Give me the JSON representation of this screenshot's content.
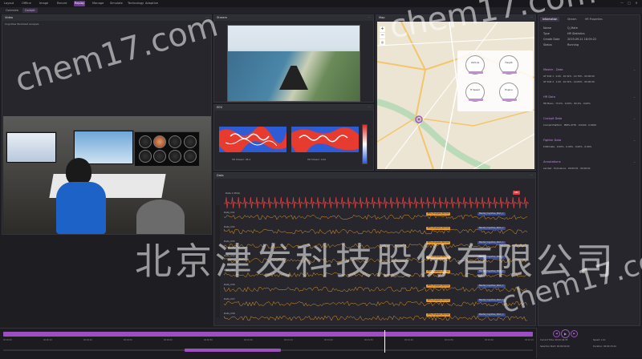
{
  "menubar": {
    "items": [
      "Layout",
      "Offline",
      "Image",
      "Record",
      "Replay",
      "Manage",
      "Simulate",
      "Technology",
      "Adaptive"
    ],
    "active_index": 4,
    "window_controls": [
      "—",
      "□",
      "✕"
    ]
  },
  "subtabs": {
    "items": [
      "Overview",
      "Cockpit"
    ],
    "active_index": 1
  },
  "video_panel": {
    "title": "Video",
    "caption": "Cognitive Workload Analysis"
  },
  "stream_panel": {
    "title": "Stream"
  },
  "map_panel": {
    "title": "Map"
  },
  "heat_panel": {
    "title": "EEG",
    "maps": [
      {
        "label": "HR Stream: 98.4"
      },
      {
        "label": "HR Stream: 0.00"
      }
    ]
  },
  "info_panel": {
    "tabs": [
      "Information",
      "Stream",
      "HR Properties"
    ],
    "rows": [
      {
        "k": "Name",
        "v": "Q_Mate"
      },
      {
        "k": "Type",
        "v": "HR Statistics"
      },
      {
        "k": "Create Date",
        "v": "2019-09-21 18:09:22"
      },
      {
        "k": "Status",
        "v": "Running"
      }
    ],
    "gauges": [
      {
        "label": "Vertical"
      },
      {
        "label": "Height"
      },
      {
        "label": "H Speed"
      },
      {
        "label": "Engine"
      }
    ],
    "sections": [
      {
        "title": "Master - Data",
        "lines": [
          "GF SCR 1 · 0.00 · 10.32% · 10.76% · 00:00:00",
          "GF SCR 2 · 1.00 · 10.32% · 10.84% · 00:00:00"
        ]
      },
      {
        "title": "HR Data",
        "lines": [
          "HR Mean · 73.0% · 0.00% · 82.4% · 0.00%"
        ]
      },
      {
        "title": "Cockpit Data",
        "lines": [
          "Cockpit Platform · PRES ATTD · 0.0000 · 0.0000"
        ]
      },
      {
        "title": "Fighter Data",
        "lines": [
          "P-RR Data · 0.00% · 0.00% · 0.00% · 0.00%"
        ]
      },
      {
        "title": "Annotations",
        "lines": [
          "Landed · Turbulence · 00:00:01 · 00:00:01"
        ]
      }
    ]
  },
  "signal_panel": {
    "title": "Data",
    "top_label": "Data 1 (ECG)",
    "rec_badge": "REC",
    "rows": [
      {
        "label": "Data_Ch1",
        "badge": "EEG_Engaged_Normal",
        "badge2": "Mental_Cognitive_Work_1"
      },
      {
        "label": "Data_Ch2",
        "badge": "EEG_Engaged_Normal",
        "badge2": "Mental_Cognitive_Work_1"
      },
      {
        "label": "Data_Ch3",
        "badge": "EEG_Engaged_Normal",
        "badge2": "Mental_Cognitive_Work_1"
      },
      {
        "label": "Data_Ch4",
        "badge": "EEG_Engaged_Normal",
        "badge2": "Mental_Cognitive_Work_1"
      },
      {
        "label": "Data_Ch5",
        "badge": "EEG_Engaged_Normal",
        "badge2": "Mental_Cognitive_Work_1"
      },
      {
        "label": "Data_Ch6",
        "badge": "EEG_Engaged_Normal",
        "badge2": "Mental_Cognitive_Work_1"
      },
      {
        "label": "Data_Ch7",
        "badge": "EEG_Engaged_Normal",
        "badge2": "Mental_Cognitive_Work_1"
      },
      {
        "label": "Data_Ch8",
        "badge": "EEG_Engaged_Normal",
        "badge2": "Mental_Cognitive_Work_1"
      }
    ]
  },
  "timeline": {
    "ticks": [
      "00:00:00",
      "00:00:10",
      "00:00:20",
      "00:00:30",
      "00:00:40",
      "00:00:50",
      "00:01:00",
      "00:01:10",
      "00:01:20",
      "00:01:30",
      "00:01:40",
      "00:01:50",
      "00:02:00",
      "00:02:10"
    ],
    "progress": 0.72
  },
  "playbar": {
    "lines": [
      "Current Time: 00:01:44.35",
      "Speed: 1.0x",
      "Selection Start: 00:00:00.00",
      "Duration: 00:02:15.44"
    ]
  },
  "watermark": {
    "latin": "chem17.com",
    "cn": "北京津发科技股份有限公司"
  },
  "colors": {
    "accent": "#9b4fc1",
    "signal": "#e89b2a",
    "ecg": "#d94040"
  },
  "icons": [
    "minimize-icon",
    "maximize-icon",
    "close-icon",
    "zoom-in-icon",
    "zoom-out-icon",
    "locate-icon",
    "play-icon",
    "prev-icon",
    "next-icon"
  ]
}
